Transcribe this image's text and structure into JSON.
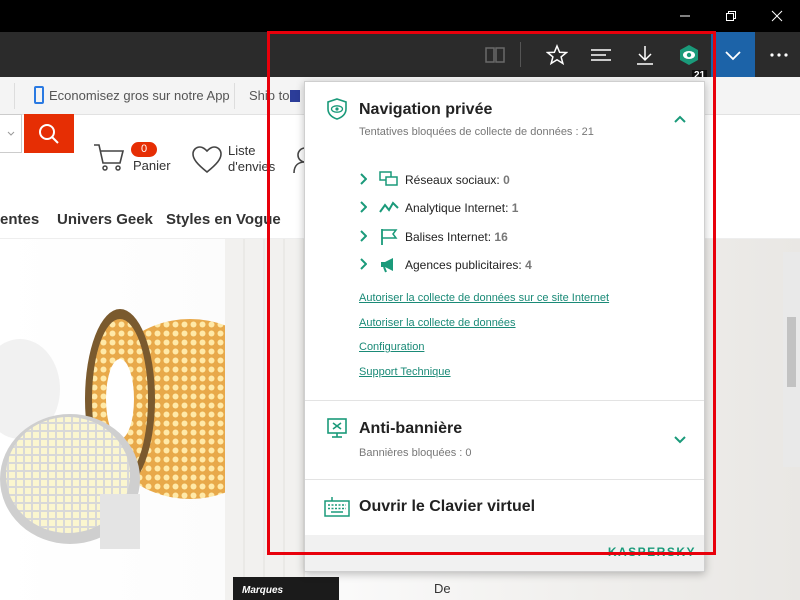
{
  "toolbar": {
    "extension_badge": "21"
  },
  "page": {
    "promo_items": [
      "Economisez gros sur notre App",
      "Ship to"
    ],
    "cart": {
      "count": "0",
      "label": "Panier"
    },
    "wishlist_label": "Liste\nd'envies",
    "nav_items": [
      "entes",
      "Univers Geek",
      "Styles en Vogue"
    ],
    "bottom_brand_label": "Marques",
    "bottom_text": "De"
  },
  "popup": {
    "private_browsing": {
      "title": "Navigation privée",
      "subtitle": "Tentatives bloquées de collecte de données : 21",
      "categories": [
        {
          "label": "Réseaux sociaux:",
          "count": "0",
          "icon": "social-networks-icon"
        },
        {
          "label": "Analytique Internet:",
          "count": "1",
          "icon": "analytics-icon"
        },
        {
          "label": "Balises Internet:",
          "count": "16",
          "icon": "beacons-icon"
        },
        {
          "label": "Agences publicitaires:",
          "count": "4",
          "icon": "ad-agencies-icon"
        }
      ],
      "links": [
        "Autoriser la collecte de données sur ce site Internet",
        "Autoriser la collecte de données",
        "Configuration",
        "Support Technique"
      ]
    },
    "anti_banner": {
      "title": "Anti-bannière",
      "subtitle": "Bannières bloquées : 0"
    },
    "keyboard": {
      "title": "Ouvrir le Clavier virtuel"
    },
    "brand": "KASPERSKY"
  },
  "colors": {
    "accent_green": "#1a9a7a",
    "link_color": "#1a8a77",
    "annotation_red": "#e8000b",
    "brand_red": "#e62e04",
    "active_extension_blue": "#1c63a8"
  }
}
